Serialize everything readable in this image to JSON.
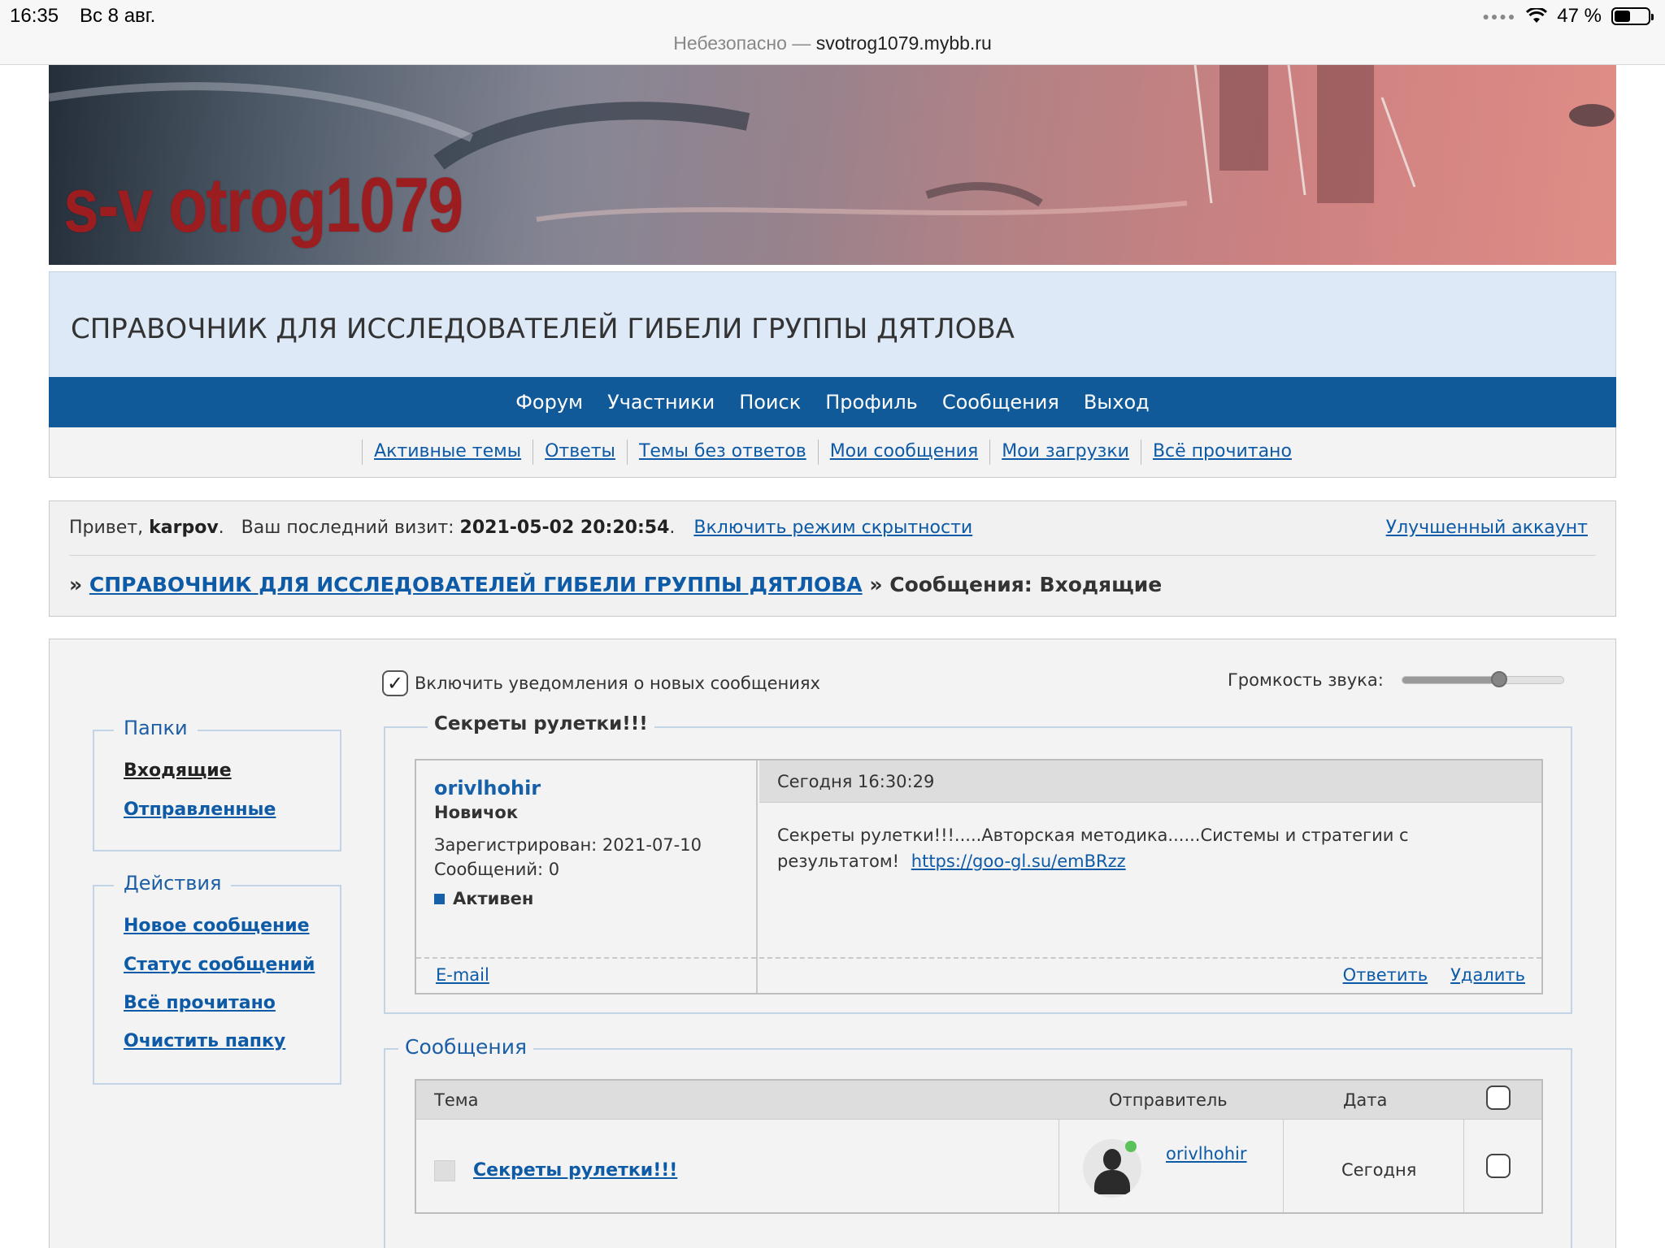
{
  "status_bar": {
    "time": "16:35",
    "date": "Вс 8 авг.",
    "battery": "47 %",
    "battery_level": 0.47,
    "url_insecure": "Небезопасно —",
    "url_host": "svotrog1079.mybb.ru"
  },
  "banner": {
    "logo": "s-v otrog1079"
  },
  "site_title": "СПРАВОЧНИК ДЛЯ ИССЛЕДОВАТЕЛЕЙ ГИБЕЛИ ГРУППЫ ДЯТЛОВА",
  "main_nav": [
    "Форум",
    "Участники",
    "Поиск",
    "Профиль",
    "Сообщения",
    "Выход"
  ],
  "sub_nav": [
    "Активные темы",
    "Ответы",
    "Темы без ответов",
    "Мои сообщения",
    "Мои загрузки",
    "Всё прочитано"
  ],
  "welcome": {
    "greeting": "Привет,",
    "username": "karpov",
    "last_visit_label": "Ваш последний визит:",
    "last_visit": "2021-05-02 20:20:54",
    "stealth_link": "Включить режим скрытности",
    "upgrade_link": "Улучшенный аккаунт"
  },
  "breadcrumbs": {
    "forum": "СПРАВОЧНИК ДЛЯ ИССЛЕДОВАТЕЛЕЙ ГИБЕЛИ ГРУППЫ ДЯТЛОВА",
    "current": "Сообщения: Входящие"
  },
  "sidebar": {
    "folders_title": "Папки",
    "folders": [
      "Входящие",
      "Отправленные"
    ],
    "actions_title": "Действия",
    "actions": [
      "Новое сообщение",
      "Статус сообщений",
      "Всё прочитано",
      "Очистить папку"
    ]
  },
  "notifications": {
    "label": "Включить уведомления о новых сообщениях",
    "checked": true,
    "volume_label": "Громкость звука:",
    "volume_level": 0.6
  },
  "message": {
    "subject": "Секреты рулетки!!!",
    "author": "orivlhohir",
    "rank": "Новичок",
    "registered": "Зарегистрирован: 2021-07-10",
    "posts": "Сообщений: 0",
    "status": "Активен",
    "email": "E-mail",
    "date": "Сегодня 16:30:29",
    "body": "Секреты рулетки!!!.....Авторская методика......Системы и стратегии с результатом!",
    "link": "https://goo-gl.su/emBRzz",
    "reply": "Ответить",
    "delete": "Удалить"
  },
  "messages_list": {
    "title": "Сообщения",
    "columns": {
      "topic": "Тема",
      "sender": "Отправитель",
      "date": "Дата"
    },
    "rows": [
      {
        "topic": "Секреты рулетки!!!",
        "sender": "orivlhohir",
        "date": "Сегодня"
      }
    ]
  }
}
